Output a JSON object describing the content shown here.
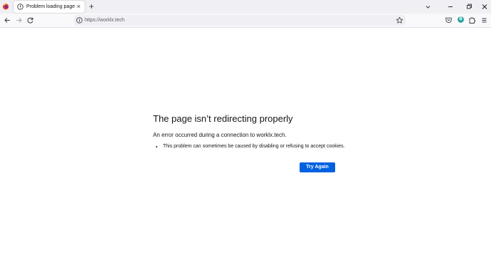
{
  "browser": {
    "tabs": [
      {
        "title": "Problem loading page",
        "close_glyph": "×",
        "icon": "warning-icon"
      }
    ],
    "new_tab_glyph": "+",
    "url": "https://worklx.tech",
    "profile_initial": "B",
    "icons": {
      "app": "firefox-icon",
      "back": "back-arrow-icon",
      "forward": "forward-arrow-icon",
      "reload": "reload-icon",
      "site_info": "site-info-icon",
      "bookmark": "bookmark-star-icon",
      "pocket": "pocket-icon",
      "extensions": "extensions-icon",
      "menu": "hamburger-menu-icon"
    },
    "colors": {
      "tabstrip": "#f0f0f4",
      "navbar": "#f9f9fb",
      "primary_button": "#0061e0",
      "avatar": "#2ea6a3"
    }
  },
  "error": {
    "title": "The page isn’t redirecting properly",
    "description": "An error occurred during a connection to worklx.tech.",
    "bullets": [
      "This problem can sometimes be caused by disabling or refusing to accept cookies."
    ],
    "try_again_label": "Try Again"
  }
}
